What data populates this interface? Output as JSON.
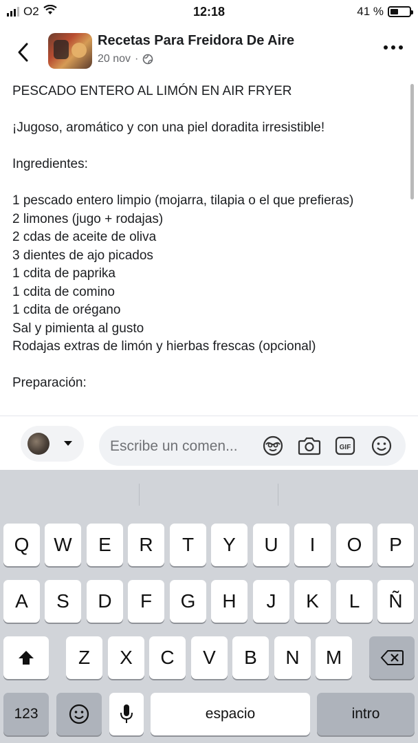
{
  "status_bar": {
    "carrier": "O2",
    "time": "12:18",
    "battery_text": "41 %",
    "battery_level": 0.41
  },
  "header": {
    "page_name": "Recetas Para Freidora De Aire",
    "date": "20 nov",
    "separator": "·"
  },
  "post": {
    "title": "PESCADO ENTERO AL LIMÓN EN AIR FRYER",
    "tagline": "¡Jugoso, aromático y con una piel doradita irresistible!",
    "ingredients_heading": "Ingredientes:",
    "ingredients": [
      "1 pescado entero limpio (mojarra, tilapia o el que prefieras)",
      "2 limones (jugo + rodajas)",
      "2 cdas de aceite de oliva",
      "3 dientes de ajo picados",
      "1 cdita de paprika",
      "1 cdita de comino",
      "1 cdita de orégano",
      "Sal y pimienta al gusto",
      "Rodajas extras de limón y hierbas frescas (opcional)"
    ],
    "preparation_heading": "Preparación:"
  },
  "comment_bar": {
    "placeholder": "Escribe un comen...",
    "icons": [
      "avatar-sticker-icon",
      "camera-icon",
      "gif-icon",
      "emoji-icon"
    ],
    "gif_label": "GIF"
  },
  "keyboard": {
    "row1": [
      "Q",
      "W",
      "E",
      "R",
      "T",
      "Y",
      "U",
      "I",
      "O",
      "P"
    ],
    "row2": [
      "A",
      "S",
      "D",
      "F",
      "G",
      "H",
      "J",
      "K",
      "L",
      "Ñ"
    ],
    "row3": [
      "Z",
      "X",
      "C",
      "V",
      "B",
      "N",
      "M"
    ],
    "numbers_label": "123",
    "space_label": "espacio",
    "return_label": "intro"
  }
}
